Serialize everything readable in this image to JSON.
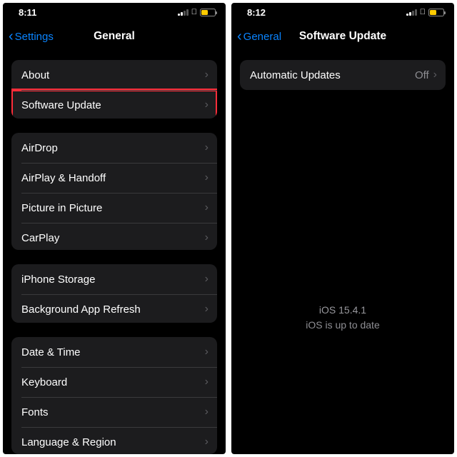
{
  "left": {
    "status": {
      "time": "8:11"
    },
    "nav": {
      "back": "Settings",
      "title": "General"
    },
    "groups": [
      {
        "rows": [
          {
            "label": "About",
            "highlight": false
          },
          {
            "label": "Software Update",
            "highlight": true
          }
        ]
      },
      {
        "rows": [
          {
            "label": "AirDrop"
          },
          {
            "label": "AirPlay & Handoff"
          },
          {
            "label": "Picture in Picture"
          },
          {
            "label": "CarPlay"
          }
        ]
      },
      {
        "rows": [
          {
            "label": "iPhone Storage"
          },
          {
            "label": "Background App Refresh"
          }
        ]
      },
      {
        "rows": [
          {
            "label": "Date & Time"
          },
          {
            "label": "Keyboard"
          },
          {
            "label": "Fonts"
          },
          {
            "label": "Language & Region"
          }
        ]
      }
    ]
  },
  "right": {
    "status": {
      "time": "8:12"
    },
    "nav": {
      "back": "General",
      "title": "Software Update"
    },
    "groups": [
      {
        "rows": [
          {
            "label": "Automatic Updates",
            "value": "Off"
          }
        ]
      }
    ],
    "versionLine": "iOS 15.4.1",
    "statusLine": "iOS is up to date"
  }
}
